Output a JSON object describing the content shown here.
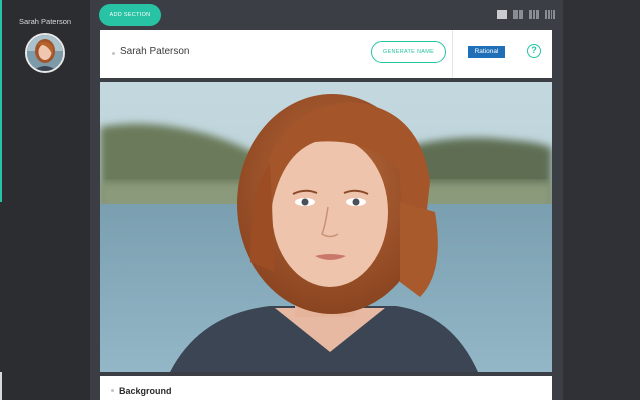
{
  "sidebar": {
    "profile_name": "Sarah Paterson",
    "avatar_icon": "portrait-avatar"
  },
  "toolbar": {
    "add_section_label": "ADD SECTION",
    "layout_toggles": [
      "one-column-icon",
      "two-column-icon",
      "three-column-icon",
      "four-column-icon"
    ],
    "active_layout": "one-column-icon"
  },
  "header": {
    "name": "Sarah Paterson",
    "generate_name_label": "GENERATE NAME",
    "personality_badge": "Rational",
    "help_icon": "?"
  },
  "photo": {
    "description_icon": "portrait-photo"
  },
  "sections": [
    {
      "title": "Background"
    }
  ],
  "colors": {
    "accent": "#27c3a4",
    "badge": "#1f6fb8",
    "sidebar": "#2b2d31",
    "canvas": "#3b3e44"
  }
}
